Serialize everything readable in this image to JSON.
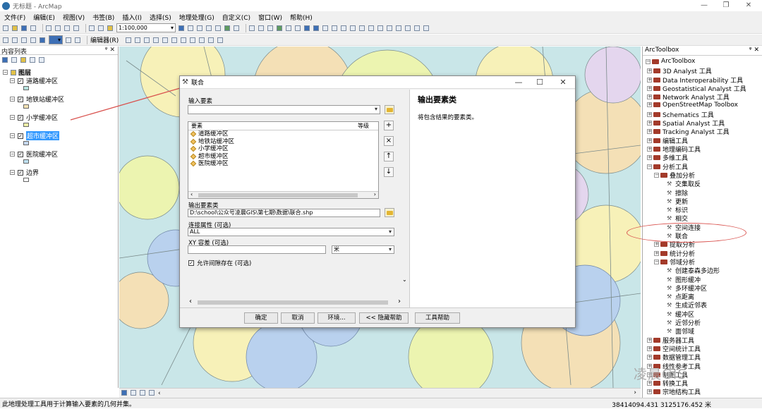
{
  "window": {
    "title": "无标题 - ArcMap"
  },
  "menu": [
    "文件(F)",
    "编辑(E)",
    "视图(V)",
    "书签(B)",
    "插入(I)",
    "选择(S)",
    "地理处理(G)",
    "自定义(C)",
    "窗口(W)",
    "帮助(H)"
  ],
  "toolbar": {
    "scale": "1:100,000",
    "editor": "编辑器(R)"
  },
  "toc": {
    "title": "内容列表",
    "group": "图层",
    "layers": [
      {
        "name": "道路缓冲区",
        "color": "#b7e4e0",
        "checked": true
      },
      {
        "name": "地铁站缓冲区",
        "color": "#f7e3b5",
        "checked": true
      },
      {
        "name": "小学缓冲区",
        "color": "#eef0a8",
        "checked": true
      },
      {
        "name": "超市缓冲区",
        "color": "#c7daf0",
        "checked": true,
        "selected": true
      },
      {
        "name": "医院缓冲区",
        "color": "#bfe0f0",
        "checked": true
      },
      {
        "name": "边界",
        "color": "#ffffff",
        "checked": true
      }
    ]
  },
  "dialog": {
    "title": "联合",
    "input_label": "输入要素",
    "list_header": {
      "col1": "要素",
      "col2": "等级"
    },
    "inputs": [
      "道路缓冲区",
      "地铁站缓冲区",
      "小学缓冲区",
      "超市缓冲区",
      "医院缓冲区"
    ],
    "output_label": "输出要素类",
    "output_value": "D:\\school\\公众号凌晨GIS\\第七期\\数据\\联合.shp",
    "join_label": "连接属性 (可选)",
    "join_value": "ALL",
    "xy_label": "XY 容差 (可选)",
    "xy_value": "",
    "xy_unit": "米",
    "gaps_label": "允许间隙存在 (可选)",
    "gaps_checked": true,
    "help_title": "输出要素类",
    "help_text": "将包含结果的要素类。",
    "buttons": {
      "ok": "确定",
      "cancel": "取消",
      "env": "环境...",
      "hide_help": "<< 隐藏帮助",
      "tool_help": "工具帮助"
    }
  },
  "toolbox": {
    "title": "ArcToolbox",
    "root": "ArcToolbox",
    "items": [
      "3D Analyst 工具",
      "Data Interoperability 工具",
      "Geostatistical Analyst 工具",
      "Network Analyst 工具",
      "OpenStreetMap Toolbox",
      "Schematics 工具",
      "Spatial Analyst 工具",
      "Tracking Analyst 工具",
      "编辑工具",
      "地理编码工具",
      "多维工具",
      "分析工具"
    ],
    "overlay": "叠加分析",
    "overlay_tools": [
      "交集取反",
      "擦除",
      "更新",
      "标识",
      "相交",
      "空间连接",
      "联合"
    ],
    "extract": "提取分析",
    "stats": "统计分析",
    "proximity": "邻域分析",
    "proximity_tools": [
      "创建泰森多边形",
      "图形缓冲",
      "多环缓冲区",
      "点距离",
      "生成近邻表",
      "缓冲区",
      "近邻分析",
      "面邻域"
    ],
    "tail": [
      "服务器工具",
      "空间统计工具",
      "数据管理工具",
      "线性参考工具",
      "制图工具",
      "转换工具",
      "宗地结构工具"
    ]
  },
  "status": {
    "text": "此地理处理工具用于计算输入要素的几何并集。",
    "coords": "38414094.431  3125176.452 米"
  },
  "watermark": "凌晨GIS",
  "colors": {
    "map_bg": "#c9e6e8",
    "accent": "#3399ff",
    "annotation": "#d9534f"
  }
}
